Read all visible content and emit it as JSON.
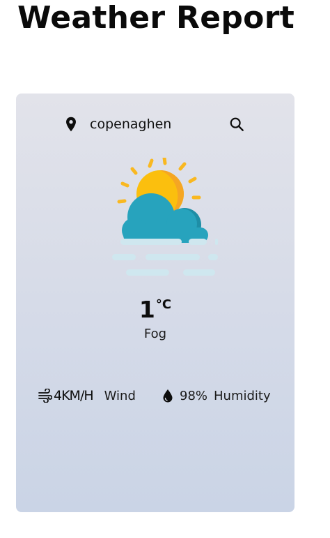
{
  "header": {
    "title": "Weather Report"
  },
  "search": {
    "city_value": "copenaghen",
    "location_icon": "map-pin-icon",
    "search_icon": "magnifier-icon"
  },
  "current": {
    "temperature": "1",
    "unit": "°C",
    "condition": "Fog",
    "illustration_icon": "sun-cloud-fog-icon"
  },
  "details": {
    "wind_value": "4KM/H",
    "wind_label": "Wind",
    "wind_icon": "wind-icon",
    "humidity_value": "98%",
    "humidity_label": "Humidity",
    "humidity_icon": "water-drop-icon"
  },
  "colors": {
    "card_top": "#e2e3ea",
    "card_bottom": "#cad4e6",
    "sun": "#fbbf0e",
    "sun_rays": "#f9b820",
    "cloud": "#27a3bd",
    "fog": "#cfe7ef"
  }
}
